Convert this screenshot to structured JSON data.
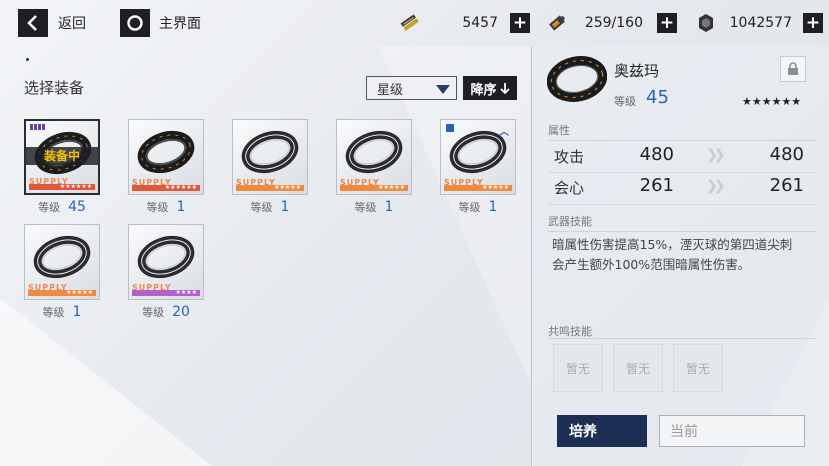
{
  "topbar": {
    "back_label": "返回",
    "home_label": "主界面",
    "resources": [
      {
        "icon": "gold-bars-icon",
        "value": "5457"
      },
      {
        "icon": "stamina-battery-icon",
        "value": "259/160"
      },
      {
        "icon": "gear-coin-icon",
        "value": "1042577"
      }
    ]
  },
  "list": {
    "title": "选择装备",
    "sort_select_value": "星级",
    "sort_order_label": "降序",
    "level_label": "等级",
    "equipped_label": "装备中",
    "supply_text": "SUPPLY",
    "items": [
      {
        "level": "45",
        "rarity_stars": "★★★★★★",
        "rarity_color": "#e2563a",
        "equipped": true,
        "variant": "dark"
      },
      {
        "level": "1",
        "rarity_stars": "★★★★★★",
        "rarity_color": "#e2563a",
        "equipped": false,
        "variant": "dark"
      },
      {
        "level": "1",
        "rarity_stars": "★★★★★",
        "rarity_color": "#f08a3c",
        "equipped": false,
        "variant": "light"
      },
      {
        "level": "1",
        "rarity_stars": "★★★★★",
        "rarity_color": "#f08a3c",
        "equipped": false,
        "variant": "light"
      },
      {
        "level": "1",
        "rarity_stars": "★★★★★",
        "rarity_color": "#f08a3c",
        "equipped": false,
        "variant": "light",
        "locked": true
      },
      {
        "level": "1",
        "rarity_stars": "★★★★★",
        "rarity_color": "#f08a3c",
        "equipped": false,
        "variant": "light"
      },
      {
        "level": "20",
        "rarity_stars": "★★★★",
        "rarity_color": "#b560c9",
        "equipped": false,
        "variant": "light"
      }
    ]
  },
  "detail": {
    "name": "奥兹玛",
    "level_label": "等级",
    "level": "45",
    "stars": "★★★★★★",
    "attr_title": "属性",
    "stats": [
      {
        "label": "攻击",
        "current": "480",
        "next": "480"
      },
      {
        "label": "会心",
        "current": "261",
        "next": "261"
      }
    ],
    "skill_title": "武器技能",
    "skill_desc": "暗属性伤害提高15%，湮灭球的第四道尖刺会产生额外100%范围暗属性伤害。",
    "resonance_title": "共鸣技能",
    "resonance_slots": [
      "暂无",
      "暂无",
      "暂无"
    ],
    "cultivate_label": "培养",
    "current_label": "当前"
  },
  "colors": {
    "accent_blue": "#2a63b5",
    "dark": "#1d1f24",
    "cultivate_bg": "#1e2f56"
  }
}
